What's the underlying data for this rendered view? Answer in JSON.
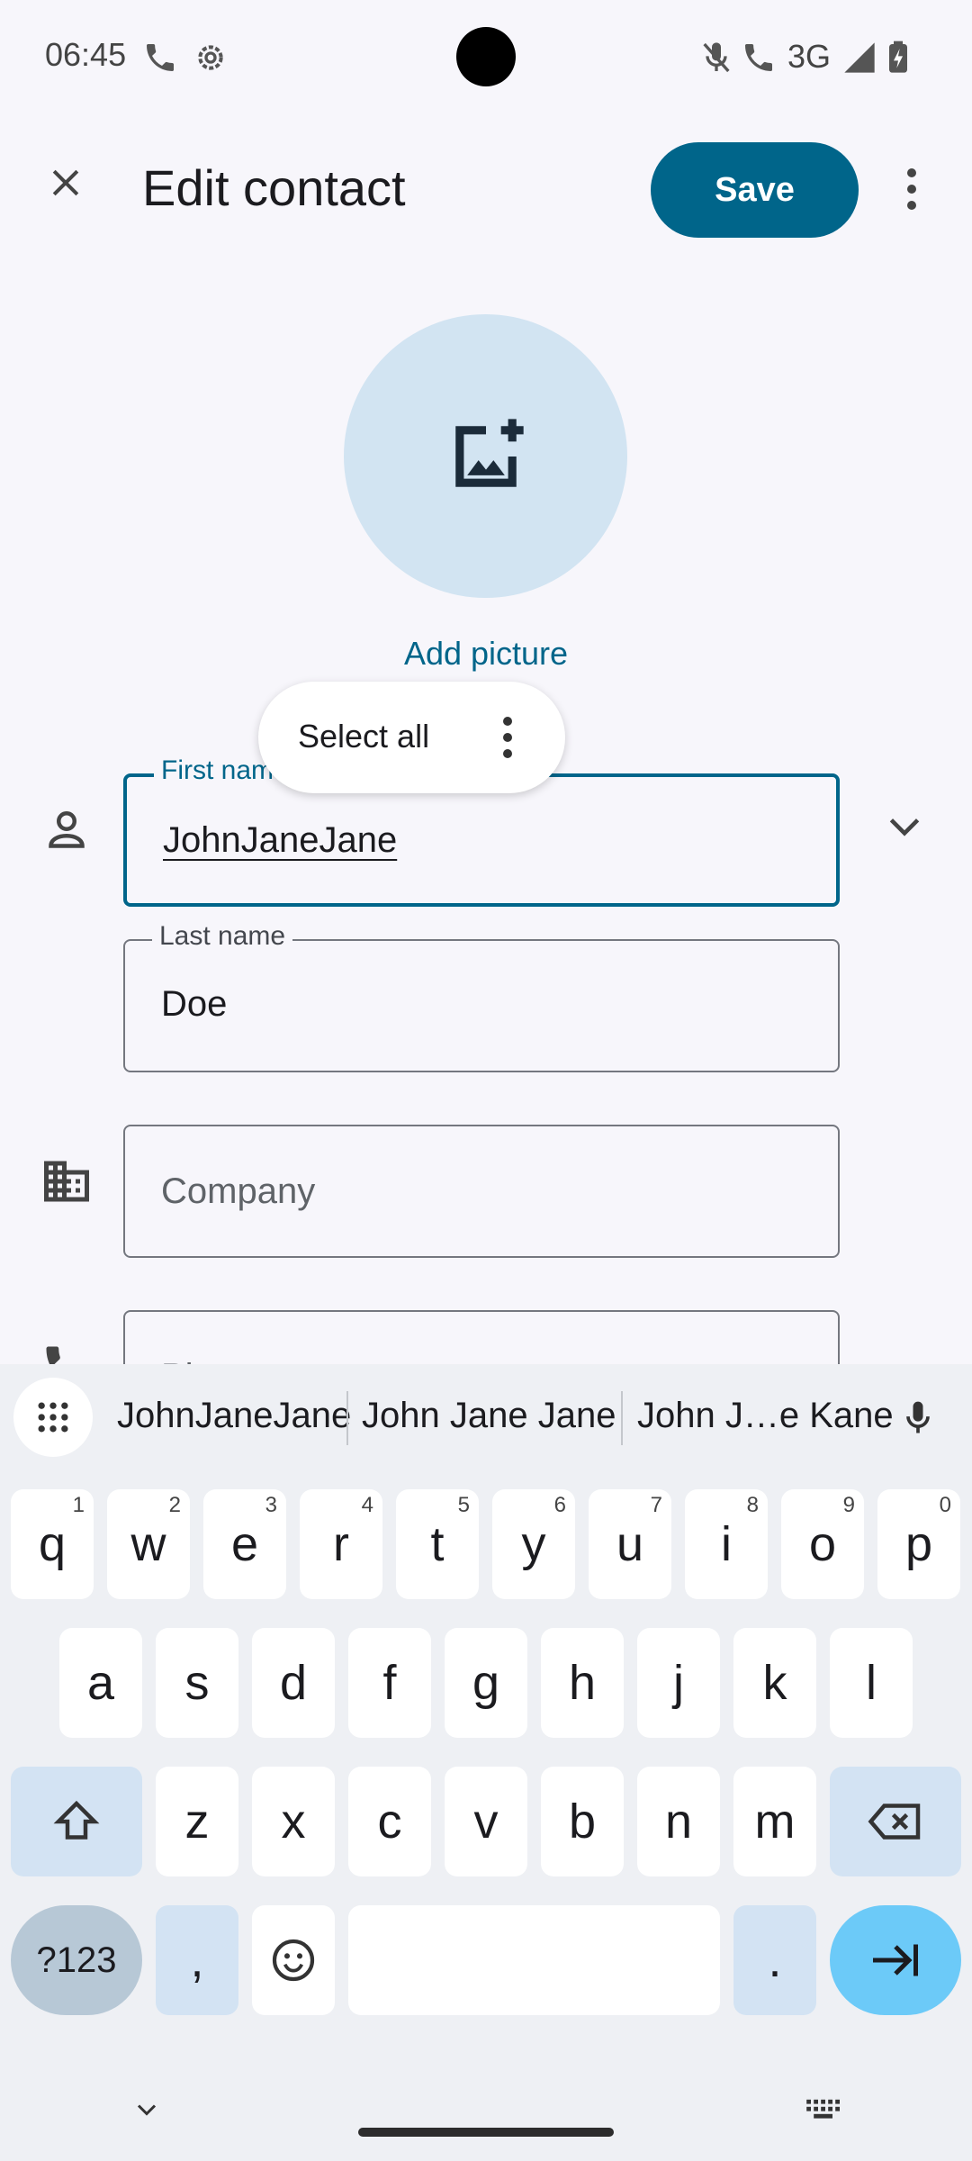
{
  "status_bar": {
    "time": "06:45",
    "network": "3G"
  },
  "app_bar": {
    "title": "Edit contact",
    "save_label": "Save"
  },
  "avatar": {
    "add_picture_label": "Add picture"
  },
  "selection_popup": {
    "select_all_label": "Select all"
  },
  "fields": {
    "first_name": {
      "label": "First name",
      "value": "JohnJaneJane"
    },
    "last_name": {
      "label": "Last name",
      "value": "Doe"
    },
    "company": {
      "placeholder": "Company"
    },
    "phone": {
      "placeholder": "Phone"
    }
  },
  "keyboard": {
    "suggestions": [
      "JohnJaneJane",
      "John Jane Jane",
      "John J…e Kane"
    ],
    "row1": [
      {
        "k": "q",
        "h": "1"
      },
      {
        "k": "w",
        "h": "2"
      },
      {
        "k": "e",
        "h": "3"
      },
      {
        "k": "r",
        "h": "4"
      },
      {
        "k": "t",
        "h": "5"
      },
      {
        "k": "y",
        "h": "6"
      },
      {
        "k": "u",
        "h": "7"
      },
      {
        "k": "i",
        "h": "8"
      },
      {
        "k": "o",
        "h": "9"
      },
      {
        "k": "p",
        "h": "0"
      }
    ],
    "row2": [
      "a",
      "s",
      "d",
      "f",
      "g",
      "h",
      "j",
      "k",
      "l"
    ],
    "row3": [
      "z",
      "x",
      "c",
      "v",
      "b",
      "n",
      "m"
    ],
    "symbols_label": "?123",
    "comma": ",",
    "period": "."
  }
}
